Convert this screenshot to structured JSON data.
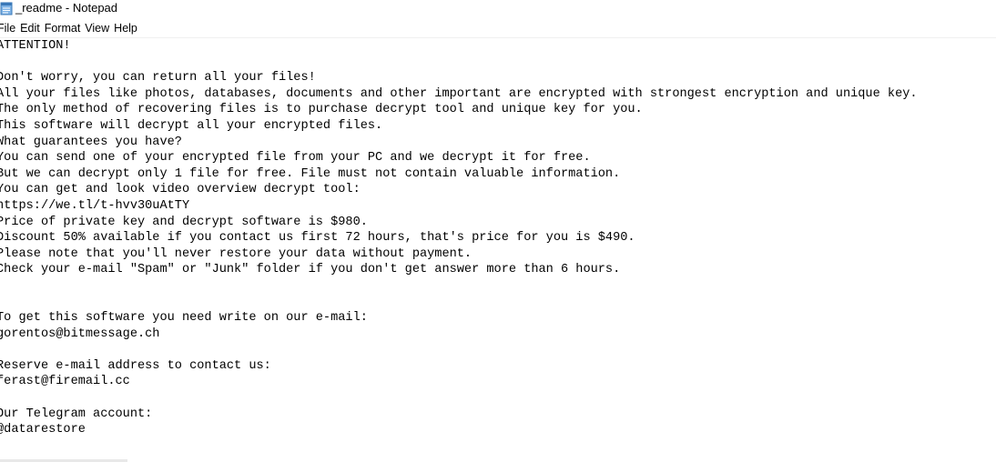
{
  "window": {
    "title": "_readme - Notepad",
    "icon": "notepad-icon"
  },
  "menu": {
    "file": "File",
    "edit": "Edit",
    "format": "Format",
    "view": "View",
    "help": "Help"
  },
  "document": {
    "lines": [
      "ATTENTION!",
      "",
      "Don't worry, you can return all your files!",
      "All your files like photos, databases, documents and other important are encrypted with strongest encryption and unique key.",
      "The only method of recovering files is to purchase decrypt tool and unique key for you.",
      "This software will decrypt all your encrypted files.",
      "What guarantees you have?",
      "You can send one of your encrypted file from your PC and we decrypt it for free.",
      "But we can decrypt only 1 file for free. File must not contain valuable information.",
      "You can get and look video overview decrypt tool:",
      "https://we.tl/t-hvv30uAtTY",
      "Price of private key and decrypt software is $980.",
      "Discount 50% available if you contact us first 72 hours, that's price for you is $490.",
      "Please note that you'll never restore your data without payment.",
      "Check your e-mail \"Spam\" or \"Junk\" folder if you don't get answer more than 6 hours.",
      "",
      "",
      "To get this software you need write on our e-mail:",
      "gorentos@bitmessage.ch",
      "",
      "Reserve e-mail address to contact us:",
      "ferast@firemail.cc",
      "",
      "Our Telegram account:",
      "@datarestore"
    ]
  }
}
